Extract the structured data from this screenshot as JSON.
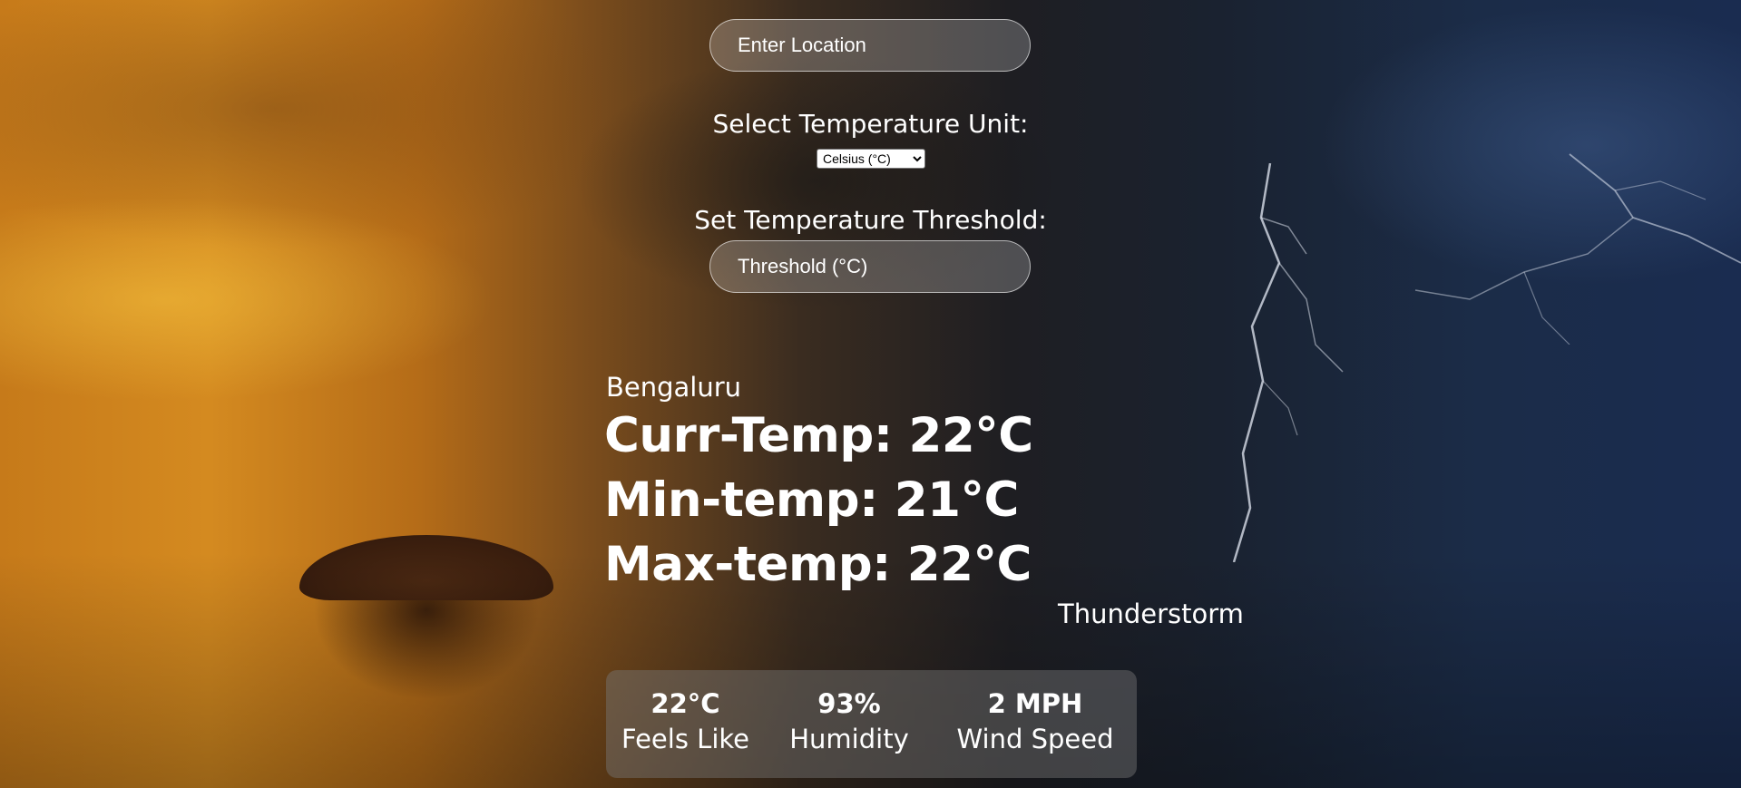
{
  "search": {
    "placeholder": "Enter Location"
  },
  "unit": {
    "label": "Select Temperature Unit:",
    "selected": "Celsius (°C)"
  },
  "threshold": {
    "label": "Set Temperature Threshold:",
    "placeholder": "Threshold (°C)"
  },
  "weather": {
    "city": "Bengaluru",
    "curr_temp": "Curr-Temp: 22°C",
    "min_temp": "Min-temp: 21°C",
    "max_temp": "Max-temp: 22°C",
    "description": "Thunderstorm"
  },
  "stats": {
    "feels_like": {
      "value": "22°C",
      "label": "Feels Like"
    },
    "humidity": {
      "value": "93%",
      "label": "Humidity"
    },
    "wind": {
      "value": "2 MPH",
      "label": "Wind Speed"
    }
  }
}
